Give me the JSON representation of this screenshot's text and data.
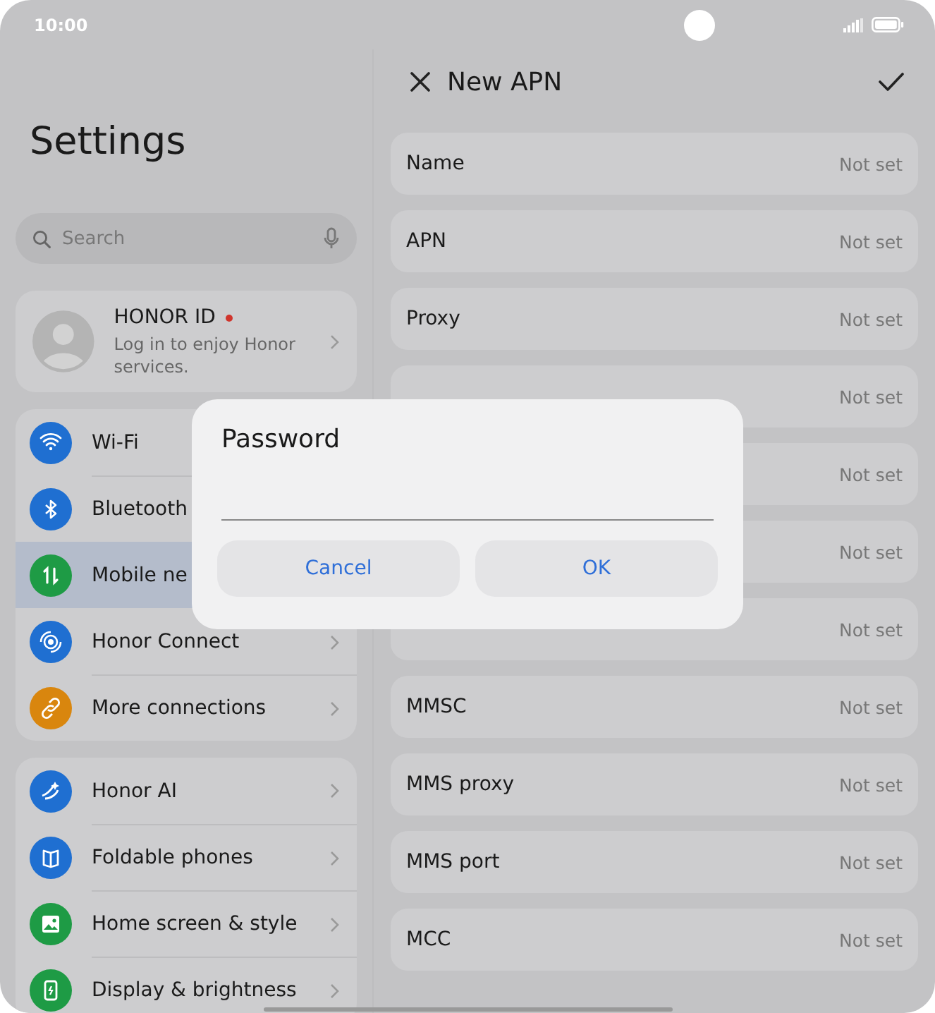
{
  "status_bar": {
    "time": "10:00"
  },
  "settings": {
    "title": "Settings",
    "search": {
      "placeholder": "Search"
    },
    "account": {
      "name": "HONOR ID",
      "notice": true,
      "subtitle": "Log in to enjoy Honor services."
    },
    "groups": [
      {
        "items": [
          {
            "label": "Wi-Fi",
            "kind": "wifi",
            "color": "#1f6fd1",
            "selected": false,
            "chevron": false
          },
          {
            "label": "Bluetooth",
            "kind": "bluetooth",
            "color": "#1f6fd1",
            "selected": false,
            "chevron": false
          },
          {
            "label": "Mobile ne",
            "kind": "mobile",
            "color": "#1e9b45",
            "selected": true,
            "chevron": false
          },
          {
            "label": "Honor Connect",
            "kind": "connect",
            "color": "#1f6fd1",
            "selected": false,
            "chevron": true
          },
          {
            "label": "More connections",
            "kind": "link",
            "color": "#d9860e",
            "selected": false,
            "chevron": true
          }
        ]
      },
      {
        "items": [
          {
            "label": "Honor AI",
            "kind": "ai",
            "color": "#1f6fd1",
            "selected": false,
            "chevron": true
          },
          {
            "label": "Foldable phones",
            "kind": "fold",
            "color": "#1f6fd1",
            "selected": false,
            "chevron": true
          },
          {
            "label": "Home screen & style",
            "kind": "image",
            "color": "#1e9b45",
            "selected": false,
            "chevron": true
          },
          {
            "label": "Display & brightness",
            "kind": "display",
            "color": "#1e9b45",
            "selected": false,
            "chevron": true
          }
        ]
      }
    ]
  },
  "apn": {
    "title": "New APN",
    "fields": [
      {
        "label": "Name",
        "value": "Not set"
      },
      {
        "label": "APN",
        "value": "Not set"
      },
      {
        "label": "Proxy",
        "value": "Not set"
      },
      {
        "value": "Not set"
      },
      {
        "value": "Not set"
      },
      {
        "value": "Not set"
      },
      {
        "value": "Not set"
      },
      {
        "label": "MMSC",
        "value": "Not set"
      },
      {
        "label": "MMS proxy",
        "value": "Not set"
      },
      {
        "label": "MMS port",
        "value": "Not set"
      },
      {
        "label": "MCC",
        "value": "Not set"
      }
    ]
  },
  "dialog": {
    "title": "Password",
    "buttons": [
      "Cancel",
      "OK"
    ]
  }
}
